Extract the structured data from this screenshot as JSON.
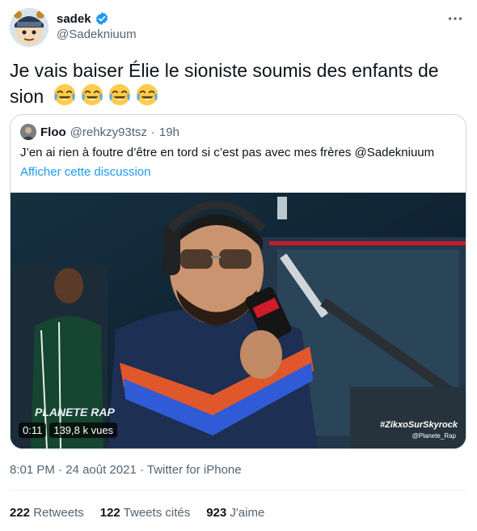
{
  "author": {
    "display_name": "sadek",
    "handle": "@Sadekniuum",
    "verified_icon": "verified-badge-icon",
    "more_icon": "more-options-icon"
  },
  "tweet": {
    "text": "Je vais baiser Élie le sioniste soumis des enfants de sion",
    "emojis": [
      "face-with-tears-of-joy",
      "face-with-tears-of-joy",
      "face-with-tears-of-joy",
      "face-with-tears-of-joy"
    ]
  },
  "quote": {
    "display_name": "Floo",
    "handle": "@rehkzy93tsz",
    "separator": "·",
    "time": "19h",
    "text": "J’en ai rien à foutre d’être en tord si c’est pas avec mes frères @Sadekniuum",
    "show_thread": "Afficher cette discussion",
    "video": {
      "duration": "0:11",
      "views": "139,8 k vues",
      "overlay_hashtag": "#ZikxoSurSkyrock",
      "overlay_handle": "@Planete_Rap",
      "overlay_logo": "PLANETE RAP"
    }
  },
  "meta": {
    "time": "8:01 PM",
    "sep1": "·",
    "date": "24 août 2021",
    "sep2": "·",
    "source": "Twitter for iPhone"
  },
  "stats": {
    "retweets_count": "222",
    "retweets_label": "Retweets",
    "quotes_count": "122",
    "quotes_label": "Tweets cités",
    "likes_count": "923",
    "likes_label": "J'aime"
  },
  "colors": {
    "accent": "#1d9bf0",
    "secondary_text": "#536471",
    "border": "#cfd9de"
  }
}
